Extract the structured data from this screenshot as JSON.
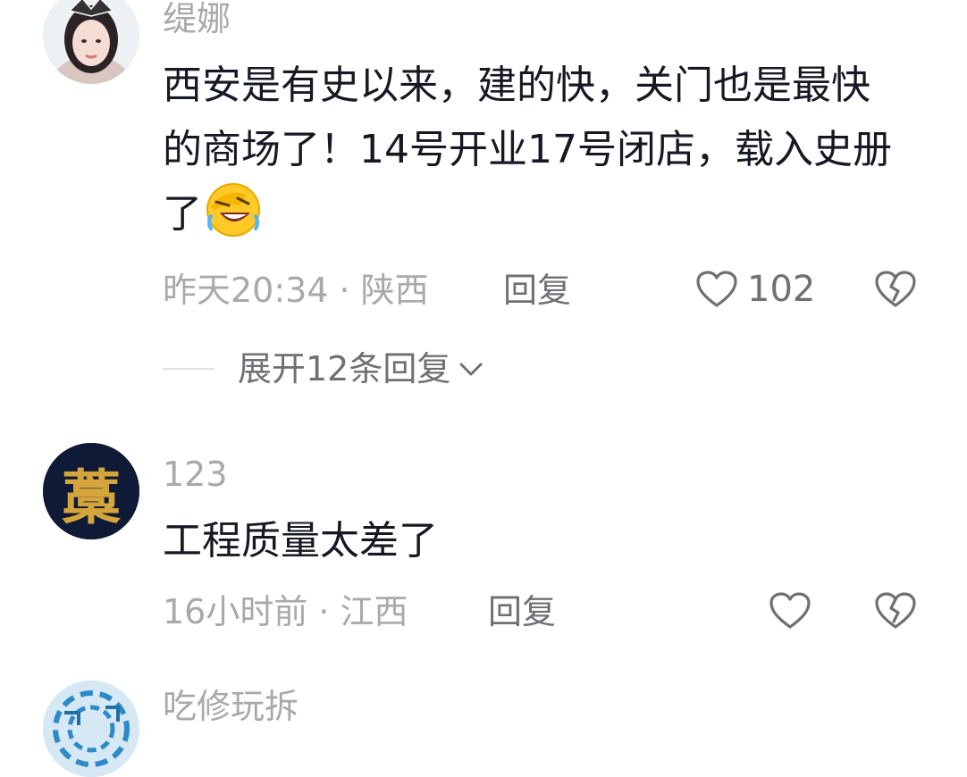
{
  "comments": [
    {
      "username": "缇娜",
      "text": "西安是有史以来，建的快，关门也是最快的商场了！14号开业17号闭店，载入史册了",
      "emoji": "facepalm-laugh-emoji",
      "time": "昨天20:34",
      "separator": "·",
      "location": "陕西",
      "reply_label": "回复",
      "like_count": "102",
      "expand_label": "展开12条回复"
    },
    {
      "username": "123",
      "avatar_char": "藁",
      "text": "工程质量太差了",
      "time": "16小时前",
      "separator": "·",
      "location": "江西",
      "reply_label": "回复"
    },
    {
      "username": "吃修玩拆"
    }
  ],
  "icons": {
    "like": "heart-outline-icon",
    "dislike": "broken-heart-icon",
    "expand": "chevron-down-icon"
  },
  "colors": {
    "primary_text": "#161823",
    "secondary_text": "#a9a9ad",
    "action_text": "#6f6f75"
  }
}
